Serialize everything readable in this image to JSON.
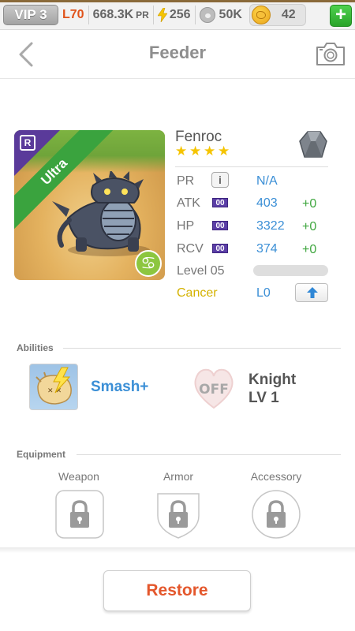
{
  "status_bar": {
    "vip": "VIP 3",
    "level": "L70",
    "power": "668.3K",
    "power_unit": "PR",
    "energy": "256",
    "food": "50K",
    "gold": "42",
    "add": "+"
  },
  "header": {
    "title": "Feeder"
  },
  "monster": {
    "rarity_letter": "R",
    "rarity": "Ultra",
    "zodiac_symbol": "♋",
    "name": "Fenroc",
    "stars": 4,
    "stats": [
      {
        "label": "PR",
        "value": "N/A",
        "bonus": ""
      },
      {
        "label": "ATK",
        "badge": "00",
        "value": "403",
        "bonus": "+0"
      },
      {
        "label": "HP",
        "badge": "00",
        "value": "3322",
        "bonus": "+0"
      },
      {
        "label": "RCV",
        "badge": "00",
        "value": "374",
        "bonus": "+0"
      }
    ],
    "level_label": "Level 05",
    "level_progress": 0.0,
    "sign": "Cancer",
    "sign_level": "L0"
  },
  "abilities": {
    "header": "Abilities",
    "active": "Smash+",
    "passive_state": "OFF",
    "passive_name": "Knight",
    "passive_level": "LV 1"
  },
  "equipment": {
    "header": "Equipment",
    "slots": [
      "Weapon",
      "Armor",
      "Accessory"
    ]
  },
  "actions": {
    "restore": "Restore"
  },
  "colors": {
    "accent_blue": "#3b8fd6",
    "bonus_green": "#3ea63e",
    "sign_yellow": "#d4b200",
    "restore_red": "#e4572c",
    "level_orange": "#e0531b"
  }
}
